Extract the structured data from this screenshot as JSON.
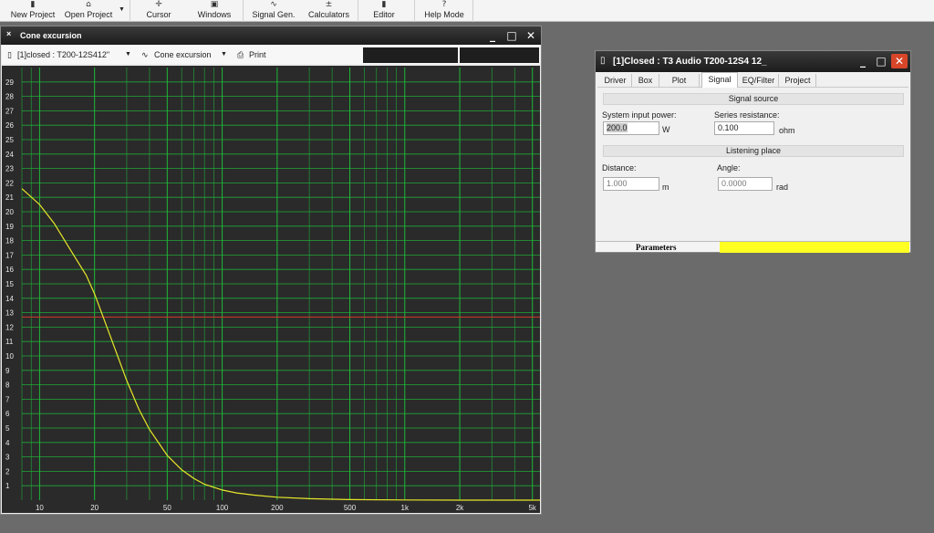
{
  "toolbar": {
    "new_project": "New Project",
    "open_project": "Open Project",
    "cursor": "Cursor",
    "windows": "Windows",
    "signal_gen": "Signal Gen.",
    "calculators": "Calculators",
    "editor": "Editor",
    "help_mode": "Help Mode"
  },
  "icons": {
    "new_project": "▮",
    "open_project": "⌂",
    "dropdown": "▼",
    "cursor": "✛",
    "windows": "▣",
    "signal_gen": "∿",
    "calculators": "±",
    "editor": "▮",
    "help_mode": "?",
    "minimize": "_",
    "maximize": "□",
    "close": "✕",
    "title_dot": "×",
    "doc": "▯",
    "wave": "∿",
    "printer": "⎙"
  },
  "cone_window": {
    "title": "Cone excursion",
    "project_select": "[1]closed : T200-12S412\"",
    "plot_select": "Cone excursion",
    "print_label": "Print"
  },
  "params_window": {
    "title": "[1]Closed : T3 Audio T200-12S4 12_",
    "tabs": [
      "Driver",
      "Box",
      "Plot",
      "Signal",
      "EQ/Filter",
      "Project"
    ],
    "active_tab": "Signal",
    "signal_source": "Signal source",
    "power_label": "System input power:",
    "power_value": "200.0",
    "power_unit": "W",
    "resistance_label": "Series resistance:",
    "resistance_value": "0.100",
    "resistance_unit": "ohm",
    "listening_place": "Listening place",
    "distance_label": "Distance:",
    "distance_value": "1.000",
    "distance_unit": "m",
    "angle_label": "Angle:",
    "angle_value": "0.0000",
    "angle_unit": "rad",
    "status_label": "Parameters"
  },
  "colors": {
    "plot_bg": "#2a2a2a",
    "grid": "#1fbf3a",
    "curve": "#e8e82a",
    "ref_line": "#d23a2a",
    "status_fill": "#ffff22"
  },
  "chart_data": {
    "type": "line",
    "x_scale": "log",
    "xlim": [
      8,
      5500
    ],
    "ylim": [
      0,
      30
    ],
    "x_tick_labels": [
      {
        "value": 10,
        "label": "10"
      },
      {
        "value": 20,
        "label": "20"
      },
      {
        "value": 50,
        "label": "50"
      },
      {
        "value": 100,
        "label": "100"
      },
      {
        "value": 200,
        "label": "200"
      },
      {
        "value": 500,
        "label": "500"
      },
      {
        "value": 1000,
        "label": "1k"
      },
      {
        "value": 2000,
        "label": "2k"
      },
      {
        "value": 5000,
        "label": "5k"
      }
    ],
    "y_ticks": [
      1,
      2,
      3,
      4,
      5,
      6,
      7,
      8,
      9,
      10,
      11,
      12,
      13,
      14,
      15,
      16,
      17,
      18,
      19,
      20,
      21,
      22,
      23,
      24,
      25,
      26,
      27,
      28,
      29
    ],
    "reference_line": 12.7,
    "series": [
      {
        "x": [
          8,
          10,
          12,
          15,
          18,
          20,
          25,
          30,
          35,
          40,
          50,
          60,
          70,
          80,
          100,
          120,
          150,
          200,
          300,
          500,
          1000,
          2000,
          5500
        ],
        "y": [
          21.6,
          20.5,
          19.2,
          17.2,
          15.6,
          14.3,
          11.0,
          8.3,
          6.3,
          4.9,
          3.1,
          2.1,
          1.5,
          1.1,
          0.7,
          0.5,
          0.35,
          0.2,
          0.1,
          0.04,
          0.01,
          0.0,
          0.0
        ]
      }
    ]
  }
}
